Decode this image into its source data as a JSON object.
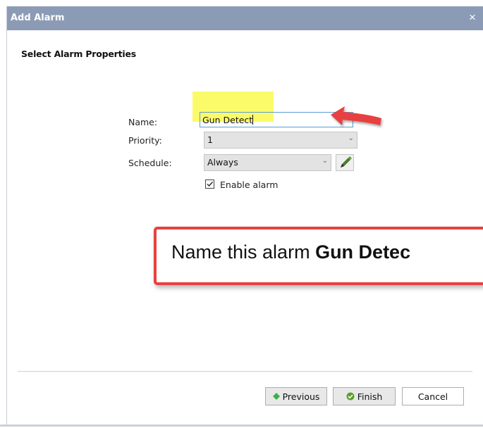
{
  "window": {
    "title": "Add Alarm",
    "close_glyph": "×",
    "close_icon": "close-icon"
  },
  "form": {
    "heading": "Select Alarm Properties",
    "name_label": "Name:",
    "name_value": "Gun Detect",
    "priority_label": "Priority:",
    "priority_value": "1",
    "schedule_label": "Schedule:",
    "schedule_value": "Always",
    "edit_schedule_icon": "pencil-icon",
    "enable_alarm_label": "Enable alarm",
    "enable_alarm_checked": true
  },
  "annotation": {
    "callout_prefix": "Name this alarm ",
    "callout_bold": "Gun Detec",
    "arrow_icon": "red-arrow-icon",
    "highlight_color": "#fbfb6a",
    "callout_border_color": "#e8413f"
  },
  "footer": {
    "previous_label": "Previous",
    "finish_label": "Finish",
    "cancel_label": "Cancel",
    "previous_icon": "green-diamond-icon",
    "finish_icon": "checkmark-circle-icon"
  },
  "colors": {
    "titlebar": "#8c9bb5",
    "input_focus_border": "#5b9bd5",
    "select_bg": "#e3e3e3"
  }
}
